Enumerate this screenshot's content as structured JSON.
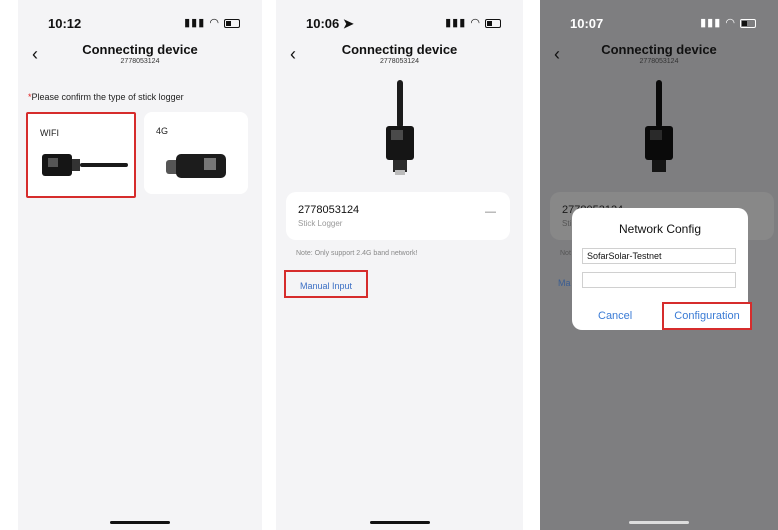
{
  "screens": [
    {
      "time": "10:12",
      "title": "Connecting device",
      "subtitle": "2778053124",
      "prompt_star": "*",
      "prompt": "Please confirm the type of stick logger",
      "options": [
        {
          "label": "WIFI"
        },
        {
          "label": "4G"
        }
      ]
    },
    {
      "time": "10:06",
      "title": "Connecting device",
      "subtitle": "2778053124",
      "serial": "2778053124",
      "serial_type": "Stick Logger",
      "serial_action": "—",
      "note": "Note: Only support 2.4G band network!",
      "manual_link": "Manual Input"
    },
    {
      "time": "10:07",
      "title": "Connecting device",
      "subtitle": "2778053124",
      "serial_partial": "2778053124",
      "serial_type_partial": "Sti",
      "note_partial": "Not",
      "manual_partial": "Ma",
      "dialog": {
        "title": "Network Config",
        "ssid_value": "SofarSolar-Testnet",
        "password_value": "",
        "cancel_label": "Cancel",
        "confirm_label": "Configuration"
      }
    }
  ],
  "colors": {
    "highlight": "#d62c2c",
    "link": "#3a7bd5"
  }
}
